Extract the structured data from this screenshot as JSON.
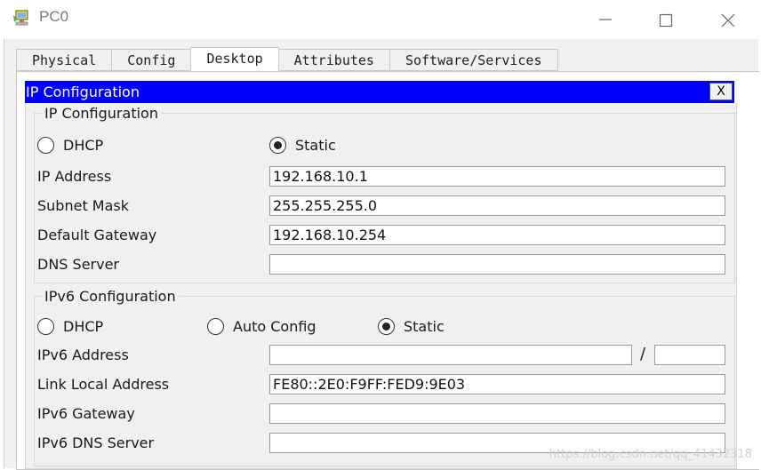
{
  "window": {
    "title": "PC0",
    "icon": "packet-tracer-pc-icon"
  },
  "tabs": [
    {
      "label": "Physical",
      "active": false
    },
    {
      "label": "Config",
      "active": false
    },
    {
      "label": "Desktop",
      "active": true
    },
    {
      "label": "Attributes",
      "active": false
    },
    {
      "label": "Software/Services",
      "active": false
    }
  ],
  "ip_window": {
    "title": "IP Configuration",
    "close_label": "X",
    "ipv4": {
      "legend": "IP Configuration",
      "mode_options": {
        "dhcp": "DHCP",
        "static": "Static"
      },
      "selected_mode": "Static",
      "ip_address": {
        "label": "IP Address",
        "value": "192.168.10.1"
      },
      "subnet_mask": {
        "label": "Subnet Mask",
        "value": "255.255.255.0"
      },
      "default_gateway": {
        "label": "Default Gateway",
        "value": "192.168.10.254"
      },
      "dns_server": {
        "label": "DNS Server",
        "value": ""
      }
    },
    "ipv6": {
      "legend": "IPv6 Configuration",
      "mode_options": {
        "dhcp": "DHCP",
        "auto": "Auto Config",
        "static": "Static"
      },
      "selected_mode": "Static",
      "ipv6_address": {
        "label": "IPv6 Address",
        "value": "",
        "prefix": ""
      },
      "prefix_separator": "/",
      "link_local": {
        "label": "Link Local Address",
        "value": "FE80::2E0:F9FF:FED9:9E03"
      },
      "ipv6_gateway": {
        "label": "IPv6 Gateway",
        "value": ""
      },
      "ipv6_dns": {
        "label": "IPv6 DNS Server",
        "value": ""
      }
    }
  },
  "watermark": "https://blog.csdn.net/qq_41432318"
}
